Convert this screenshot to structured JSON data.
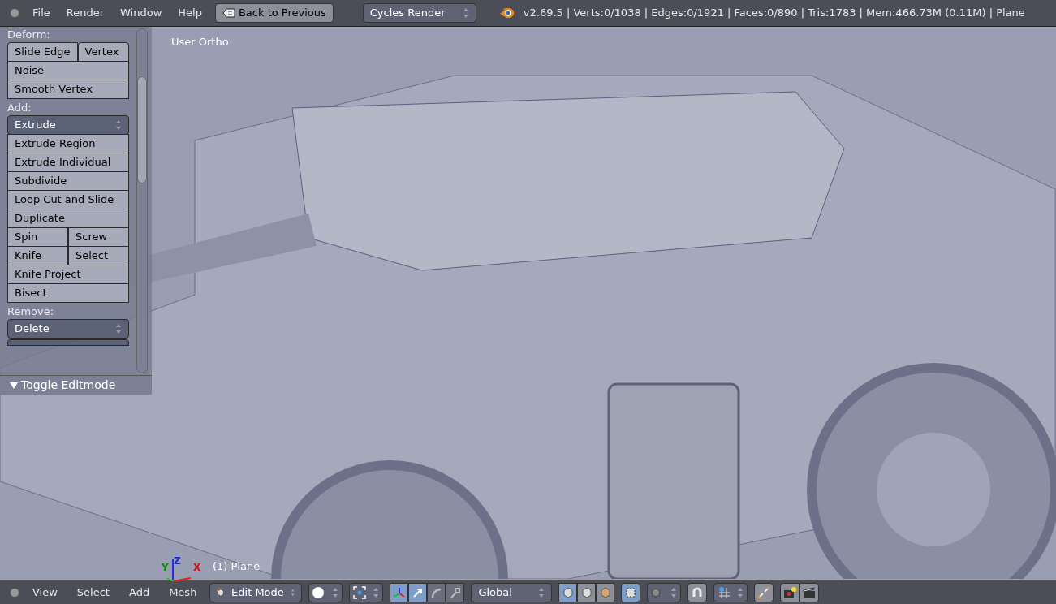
{
  "menu_bar": {
    "menus": [
      "File",
      "Render",
      "Window",
      "Help"
    ],
    "back_button": "Back to Previous",
    "engine": "Cycles Render",
    "stats": "v2.69.5 | Verts:0/1038 | Edges:0/1921 | Faces:0/890 | Tris:1783 | Mem:466.73M (0.11M) | Plane"
  },
  "tool_shelf": {
    "sections": [
      {
        "heading": "Deform:",
        "rows": [
          [
            {
              "label": "Slide Edge",
              "kind": "button"
            },
            {
              "label": "Vertex",
              "kind": "button"
            }
          ],
          [
            {
              "label": "Noise",
              "kind": "button"
            }
          ],
          [
            {
              "label": "Smooth Vertex",
              "kind": "button"
            }
          ]
        ]
      },
      {
        "heading": "Add:",
        "rows": [
          [
            {
              "label": "Extrude",
              "kind": "dropdown"
            }
          ],
          [
            {
              "label": "Extrude Region",
              "kind": "button"
            }
          ],
          [
            {
              "label": "Extrude Individual",
              "kind": "button"
            }
          ],
          [
            {
              "label": "Subdivide",
              "kind": "button"
            }
          ],
          [
            {
              "label": "Loop Cut and Slide",
              "kind": "button"
            }
          ],
          [
            {
              "label": "Duplicate",
              "kind": "button"
            }
          ],
          [
            {
              "label": "Spin",
              "kind": "button"
            },
            {
              "label": "Screw",
              "kind": "button"
            }
          ],
          [
            {
              "label": "Knife",
              "kind": "button"
            },
            {
              "label": "Select",
              "kind": "button"
            }
          ],
          [
            {
              "label": "Knife Project",
              "kind": "button"
            }
          ],
          [
            {
              "label": "Bisect",
              "kind": "button"
            }
          ]
        ]
      },
      {
        "heading": "Remove:",
        "rows": [
          [
            {
              "label": "Delete",
              "kind": "dropdown"
            }
          ]
        ]
      }
    ],
    "operator_panel": {
      "title": "Toggle Editmode",
      "expanded": true
    }
  },
  "viewport": {
    "view_label": "User Ortho",
    "object_label": "(1) Plane",
    "axes": [
      "X",
      "Y",
      "Z"
    ]
  },
  "bottom_bar": {
    "menus": [
      "View",
      "Select",
      "Add",
      "Mesh"
    ],
    "mode": "Edit Mode",
    "orientation": "Global",
    "manipulators": [
      {
        "selected": true
      },
      {
        "selected": true
      },
      {
        "selected": false
      },
      {
        "selected": false
      }
    ],
    "select_modes": [
      {
        "selected": true
      },
      {
        "selected": false
      },
      {
        "selected": false
      }
    ]
  }
}
